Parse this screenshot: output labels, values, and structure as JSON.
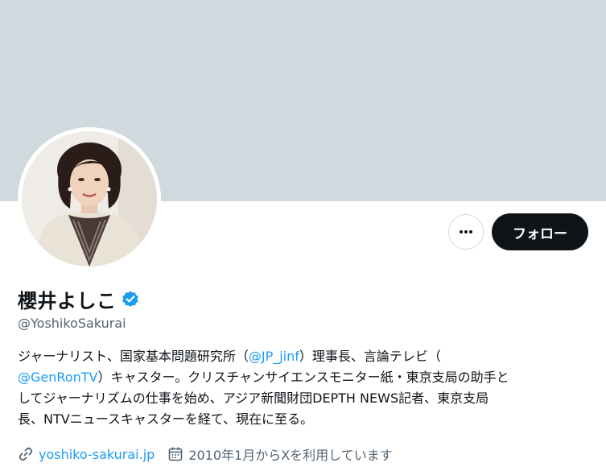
{
  "profile": {
    "display_name": "櫻井よしこ",
    "handle": "@YoshikoSakurai",
    "verified_icon": "verified-badge-icon",
    "bio": {
      "p1": "ジャーナリスト、国家基本問題研究所（",
      "mention1": "@JP_jinf",
      "p2": "）理事長、言論テレビ（\n",
      "mention2": "@GenRonTV",
      "p3": "）キャスター。クリスチャンサイエンスモニター紙・東京支局の助手と\nしてジャーナリズムの仕事を始め、アジア新聞財団DEPTH NEWS記者、東京支局\n長、NTVニュースキャスターを経て、現在に至る。"
    },
    "website": "yoshiko-sakurai.jp",
    "joined": "2010年1月からXを利用しています"
  },
  "actions": {
    "follow_label": "フォロー",
    "more_icon": "more-options-icon"
  },
  "colors": {
    "banner": "#cfd9de",
    "accent": "#1d9bf0",
    "text": "#0f1419",
    "secondary_text": "#536471",
    "follow_bg": "#0f1419"
  }
}
